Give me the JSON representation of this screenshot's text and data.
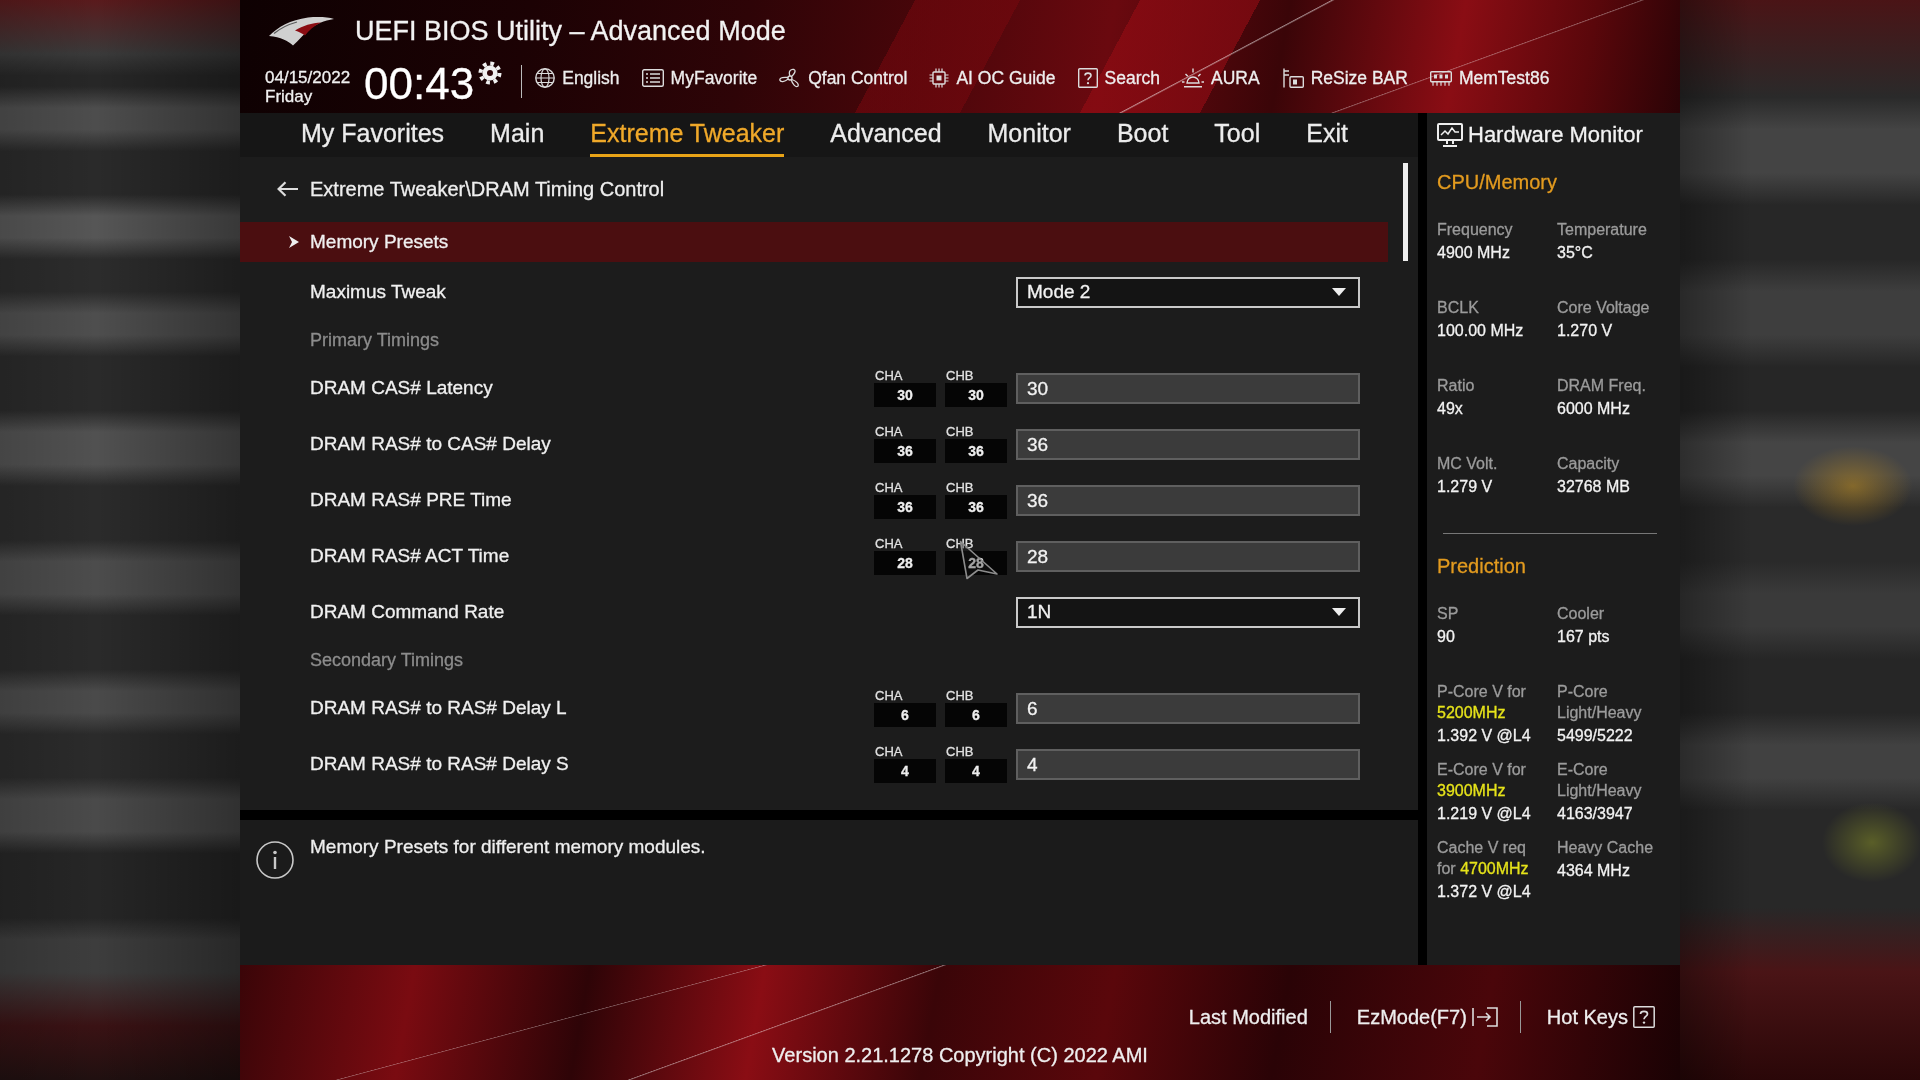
{
  "header": {
    "title": "UEFI BIOS Utility – Advanced Mode",
    "date": "04/15/2022",
    "day": "Friday",
    "time": "00:43",
    "tools": [
      "English",
      "MyFavorite",
      "Qfan Control",
      "AI OC Guide",
      "Search",
      "AURA",
      "ReSize BAR",
      "MemTest86"
    ]
  },
  "tabs": [
    {
      "label": "My Favorites",
      "selected": false
    },
    {
      "label": "Main",
      "selected": false
    },
    {
      "label": "Extreme Tweaker",
      "selected": true
    },
    {
      "label": "Advanced",
      "selected": false
    },
    {
      "label": "Monitor",
      "selected": false
    },
    {
      "label": "Boot",
      "selected": false
    },
    {
      "label": "Tool",
      "selected": false
    },
    {
      "label": "Exit",
      "selected": false
    }
  ],
  "breadcrumb": "Extreme Tweaker\\DRAM Timing Control",
  "settings": [
    {
      "kind": "submenu",
      "label": "Memory Presets",
      "selected": true
    },
    {
      "kind": "dropdown",
      "label": "Maximus Tweak",
      "value": "Mode 2",
      "selected": false
    },
    {
      "kind": "heading",
      "label": "Primary Timings"
    },
    {
      "kind": "timing",
      "label": "DRAM CAS# Latency",
      "channels": [
        {
          "name": "CHA",
          "value": "30"
        },
        {
          "name": "CHB",
          "value": "30"
        }
      ],
      "value": "30",
      "selected": false
    },
    {
      "kind": "timing",
      "label": "DRAM RAS# to CAS# Delay",
      "channels": [
        {
          "name": "CHA",
          "value": "36"
        },
        {
          "name": "CHB",
          "value": "36"
        }
      ],
      "value": "36",
      "selected": false
    },
    {
      "kind": "timing",
      "label": "DRAM RAS# PRE Time",
      "channels": [
        {
          "name": "CHA",
          "value": "36"
        },
        {
          "name": "CHB",
          "value": "36"
        }
      ],
      "value": "36",
      "selected": false
    },
    {
      "kind": "timing",
      "label": "DRAM RAS# ACT Time",
      "channels": [
        {
          "name": "CHA",
          "value": "28"
        },
        {
          "name": "CHB",
          "value": "28"
        }
      ],
      "value": "28",
      "selected": false
    },
    {
      "kind": "dropdown",
      "label": "DRAM Command Rate",
      "value": "1N",
      "selected": false
    },
    {
      "kind": "heading",
      "label": "Secondary Timings"
    },
    {
      "kind": "timing",
      "label": "DRAM RAS# to RAS# Delay L",
      "channels": [
        {
          "name": "CHA",
          "value": "6"
        },
        {
          "name": "CHB",
          "value": "6"
        }
      ],
      "value": "6",
      "selected": false
    },
    {
      "kind": "timing",
      "label": "DRAM RAS# to RAS# Delay S",
      "channels": [
        {
          "name": "CHA",
          "value": "4"
        },
        {
          "name": "CHB",
          "value": "4"
        }
      ],
      "value": "4",
      "selected": false
    }
  ],
  "help_text": "Memory Presets for different memory modules.",
  "hardware_monitor": {
    "title": "Hardware Monitor",
    "sections": [
      {
        "title": "CPU/Memory",
        "items": [
          {
            "label": "Frequency",
            "value": "4900 MHz"
          },
          {
            "label": "Temperature",
            "value": "35°C"
          },
          {
            "label": "BCLK",
            "value": "100.00 MHz"
          },
          {
            "label": "Core Voltage",
            "value": "1.270 V"
          },
          {
            "label": "Ratio",
            "value": "49x"
          },
          {
            "label": "DRAM Freq.",
            "value": "6000 MHz"
          },
          {
            "label": "MC Volt.",
            "value": "1.279 V"
          },
          {
            "label": "Capacity",
            "value": "32768 MB"
          }
        ]
      },
      {
        "title": "Prediction",
        "items": [
          {
            "label": "SP",
            "value": "90"
          },
          {
            "label": "Cooler",
            "value": "167 pts"
          },
          {
            "label": "P-Core V for",
            "frequency": "5200MHz",
            "value": "1.392 V @L4"
          },
          {
            "label": "P-Core Light/Heavy",
            "value": "5499/5222"
          },
          {
            "label": "E-Core V for",
            "frequency": "3900MHz",
            "value": "1.219 V @L4"
          },
          {
            "label": "E-Core Light/Heavy",
            "value": "4163/3947"
          },
          {
            "label": "Cache V req for",
            "frequency": "4700MHz",
            "value": "1.372 V @L4"
          },
          {
            "label": "Heavy Cache",
            "value": "4364 MHz"
          }
        ]
      }
    ]
  },
  "footer": {
    "actions": [
      "Last Modified",
      "EzMode(F7)",
      "Hot Keys"
    ],
    "version": "Version 2.21.1278 Copyright (C) 2022 AMI"
  }
}
